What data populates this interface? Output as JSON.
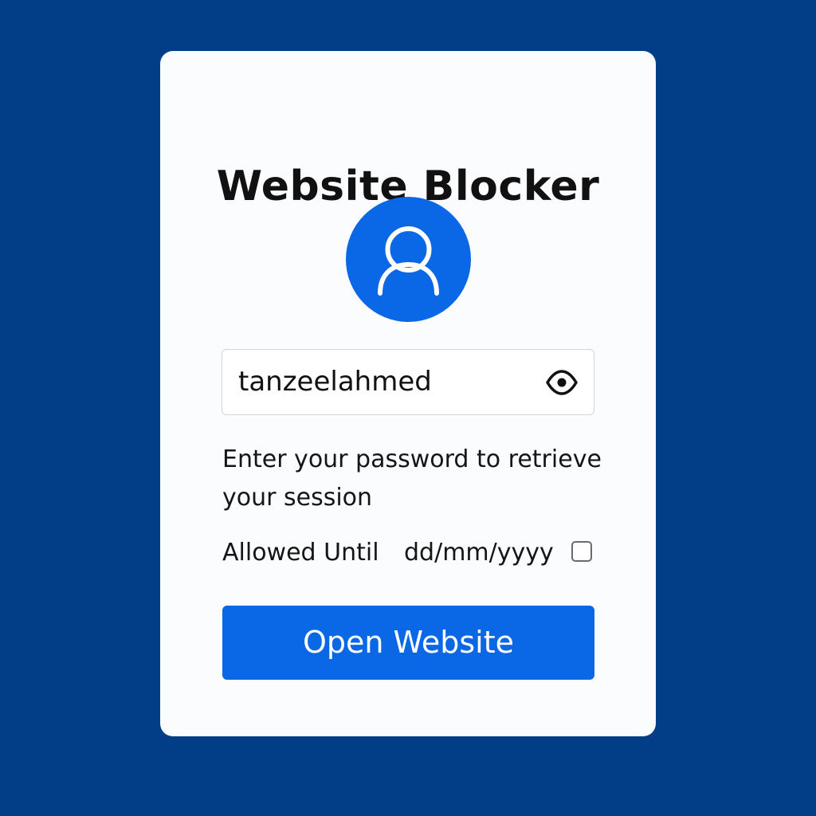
{
  "app": {
    "title": "Website Blocker"
  },
  "login": {
    "username_value": "tanzeelahmed",
    "toggle_icon": "eye-icon",
    "help_text": "Enter your password to retrieve your session",
    "allowed_until_label": "Allowed Until",
    "date_placeholder": "dd/mm/yyyy",
    "allowed_checked": false,
    "submit_label": "Open Website"
  },
  "icons": {
    "avatar": "user-icon"
  },
  "colors": {
    "background": "#023e87",
    "card": "#fbfcfd",
    "accent": "#0a67e6",
    "text": "#111111",
    "input_border": "#d2d6db"
  }
}
